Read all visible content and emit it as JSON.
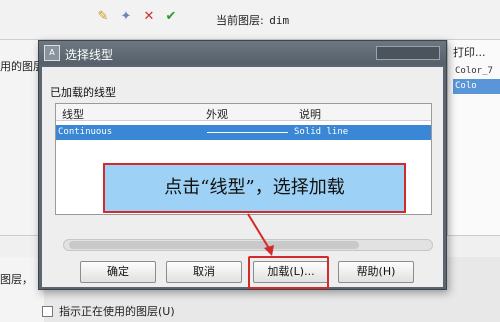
{
  "toolbar": {
    "icons": [
      "new-layer-icon",
      "new-layer-vp-icon",
      "delete-layer-icon",
      "set-current-icon"
    ],
    "current_layer_label": "当前图层:",
    "current_layer_value": "dim"
  },
  "background": {
    "left_text_top": "用的图层",
    "left_text_bottom": "图层，",
    "print_header": "打印...",
    "print_rows": [
      "Color_7",
      "Colo"
    ],
    "bottom_checkbox_label": "指示正在使用的图层(U)"
  },
  "dialog": {
    "title": "选择线型",
    "loaded_label": "已加载的线型",
    "columns": [
      "线型",
      "外观",
      "说明"
    ],
    "rows": [
      {
        "linetype": "Continuous",
        "description": "Solid line"
      }
    ],
    "buttons": {
      "ok": "确定",
      "cancel": "取消",
      "load": "加载(L)...",
      "help": "帮助(H)"
    }
  },
  "annotation": {
    "text": "点击“线型”，选择加载",
    "color": "#d32a2a"
  }
}
